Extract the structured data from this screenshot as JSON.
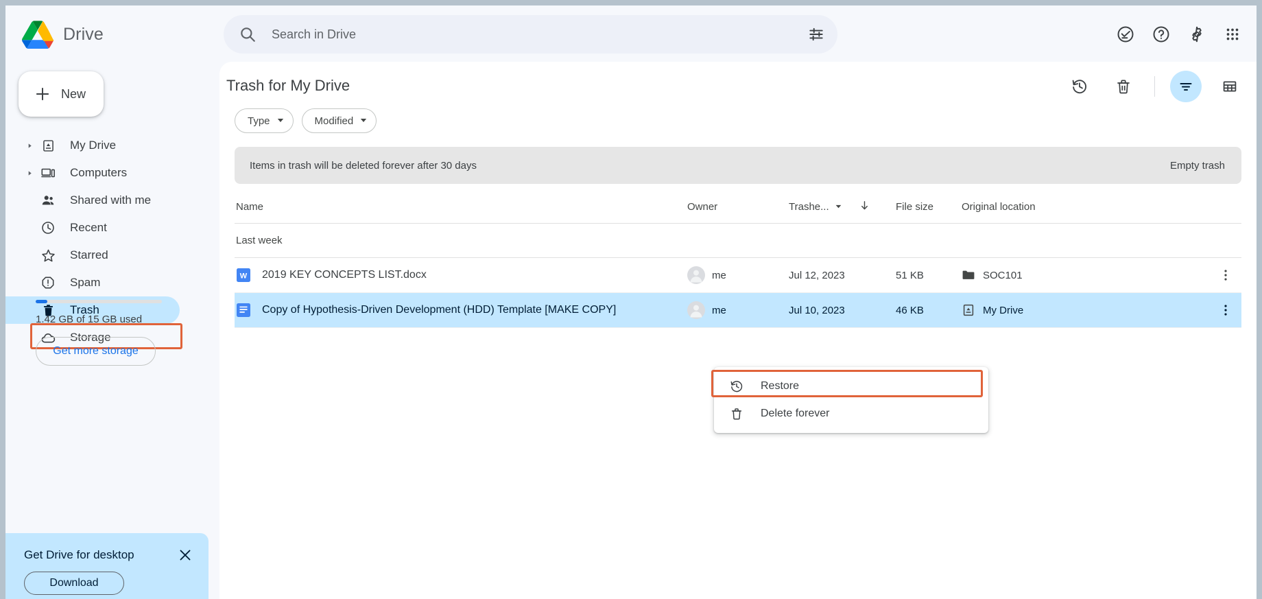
{
  "app": {
    "brand_name": "Drive",
    "logo_icon": "google-drive-logo"
  },
  "search": {
    "placeholder": "Search in Drive",
    "value": "",
    "search_icon": "search-icon",
    "options_icon": "tune-icon"
  },
  "topbar_icons": [
    {
      "name": "activity-icon",
      "label": "Support / activity"
    },
    {
      "name": "help-icon",
      "label": "Help"
    },
    {
      "name": "gear-icon",
      "label": "Settings"
    },
    {
      "name": "apps-grid-icon",
      "label": "Google apps"
    }
  ],
  "sidebar": {
    "new_button": "New",
    "items": [
      {
        "label": "My Drive",
        "icon": "my-drive-icon",
        "expandable": true,
        "active": false
      },
      {
        "label": "Computers",
        "icon": "computers-icon",
        "expandable": true,
        "active": false
      },
      {
        "label": "Shared with me",
        "icon": "people-icon",
        "expandable": false,
        "active": false
      },
      {
        "label": "Recent",
        "icon": "clock-icon",
        "expandable": false,
        "active": false
      },
      {
        "label": "Starred",
        "icon": "star-icon",
        "expandable": false,
        "active": false
      },
      {
        "label": "Spam",
        "icon": "spam-icon",
        "expandable": false,
        "active": false
      },
      {
        "label": "Trash",
        "icon": "trash-icon",
        "expandable": false,
        "active": true
      },
      {
        "label": "Storage",
        "icon": "cloud-icon",
        "expandable": false,
        "active": false
      }
    ],
    "storage": {
      "used_text": "1.42 GB of 15 GB used",
      "percent_used": 9.5,
      "get_more_label": "Get more storage"
    },
    "desktop_promo": {
      "title": "Get Drive for desktop",
      "download_label": "Download",
      "close_icon": "close-icon"
    }
  },
  "main": {
    "page_title": "Trash for My Drive",
    "head_actions": [
      {
        "name": "restore-history-icon",
        "active": false
      },
      {
        "name": "empty-trash-icon",
        "active": false
      },
      {
        "name": "list-view-icon",
        "active": true
      },
      {
        "name": "grid-view-icon",
        "active": false
      }
    ],
    "chips": [
      {
        "label": "Type"
      },
      {
        "label": "Modified"
      }
    ],
    "banner": {
      "text": "Items in trash will be deleted forever after 30 days",
      "action": "Empty trash"
    },
    "columns": {
      "name": "Name",
      "owner": "Owner",
      "trashed": "Trashe...",
      "file_size": "File size",
      "original_location": "Original location",
      "sort_direction_icon": "arrow-down-icon",
      "sort_dropdown_icon": "caret-down-icon"
    },
    "group_label": "Last week",
    "rows": [
      {
        "name": "2019 KEY CONCEPTS LIST.docx",
        "file_icon": "word-doc-icon",
        "owner": "me",
        "trashed": "Jul 12, 2023",
        "file_size": "51 KB",
        "original_location": "SOC101",
        "location_icon": "folder-icon",
        "selected": false
      },
      {
        "name": "Copy of Hypothesis-Driven Development (HDD) Template [MAKE COPY]",
        "file_icon": "google-doc-icon",
        "owner": "me",
        "trashed": "Jul 10, 2023",
        "file_size": "46 KB",
        "original_location": "My Drive",
        "location_icon": "my-drive-icon",
        "selected": true
      }
    ]
  },
  "context_menu": {
    "items": [
      {
        "label": "Restore",
        "icon": "restore-icon",
        "highlighted": true
      },
      {
        "label": "Delete forever",
        "icon": "trash-icon",
        "highlighted": false
      }
    ]
  },
  "annotations": {
    "color": "#e0633a",
    "targets": [
      "sidebar-item-trash",
      "context-menu-item-restore"
    ]
  }
}
